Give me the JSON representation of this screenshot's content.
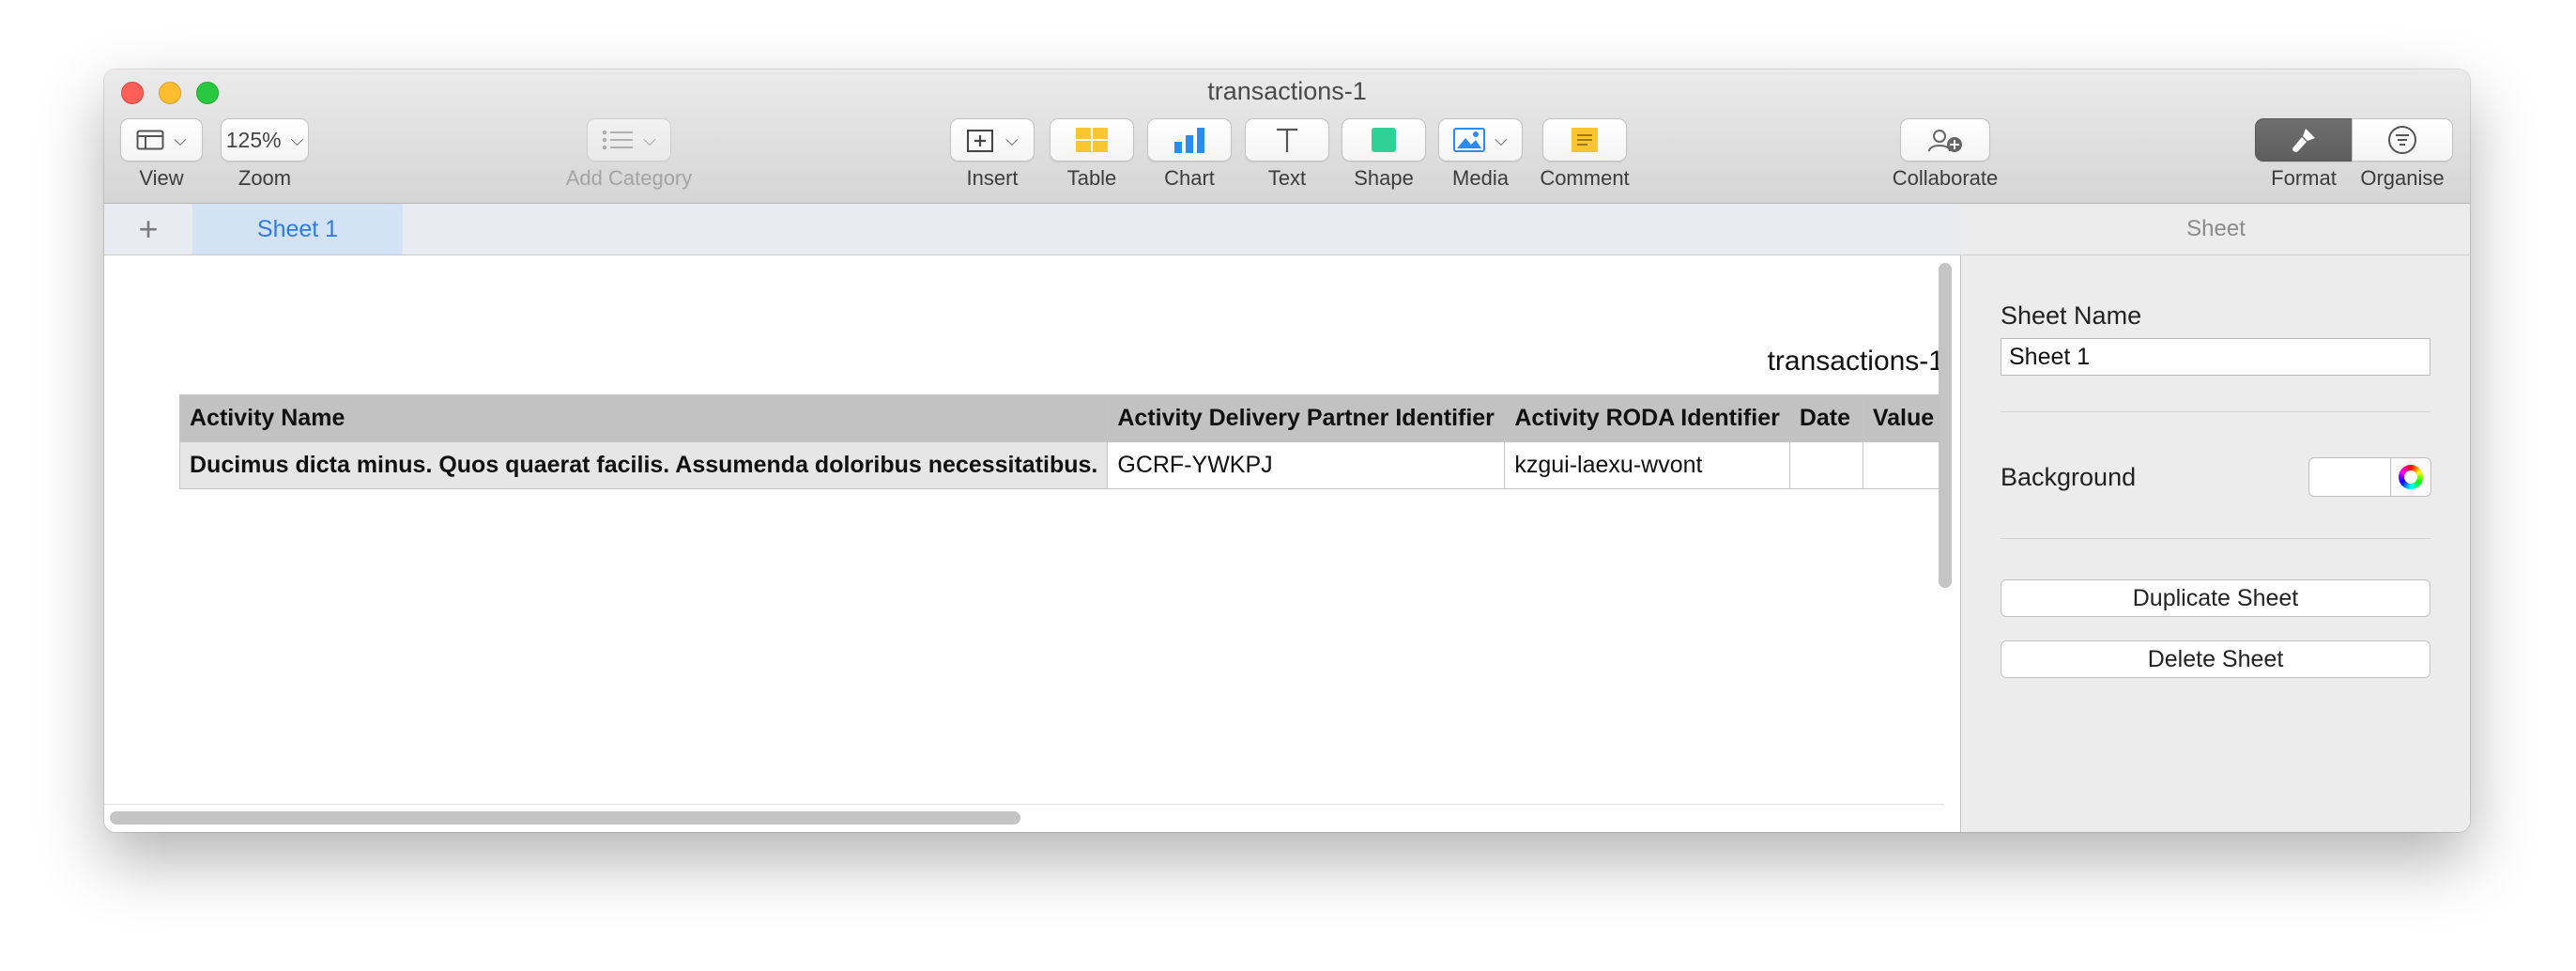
{
  "window": {
    "title": "transactions-1"
  },
  "toolbar": {
    "view_label": "View",
    "zoom_value": "125%",
    "zoom_label": "Zoom",
    "add_category_label": "Add Category",
    "insert_label": "Insert",
    "table_label": "Table",
    "chart_label": "Chart",
    "text_label": "Text",
    "shape_label": "Shape",
    "media_label": "Media",
    "comment_label": "Comment",
    "collaborate_label": "Collaborate",
    "format_label": "Format",
    "organise_label": "Organise"
  },
  "sheets": {
    "add_symbol": "+",
    "tabs": [
      "Sheet 1"
    ]
  },
  "canvas": {
    "table_title": "transactions-1",
    "columns": [
      "Activity Name",
      "Activity Delivery Partner Identifier",
      "Activity RODA Identifier",
      "Date",
      "Value"
    ],
    "rows": [
      [
        "Ducimus dicta minus. Quos quaerat facilis. Assumenda doloribus necessitatibus.",
        "GCRF-YWKPJ",
        "kzgui-laexu-wvont",
        "",
        ""
      ]
    ]
  },
  "inspector": {
    "header": "Sheet",
    "sheet_name_label": "Sheet Name",
    "sheet_name_value": "Sheet 1",
    "background_label": "Background",
    "background_color": "#ffffff",
    "duplicate_label": "Duplicate Sheet",
    "delete_label": "Delete Sheet"
  }
}
